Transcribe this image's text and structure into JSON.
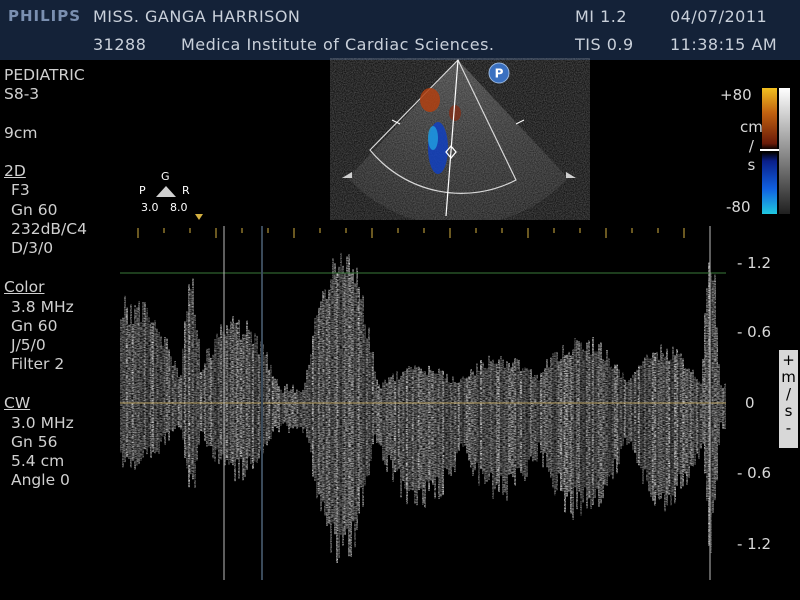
{
  "header": {
    "logo": "PHILIPS",
    "patient_name": "MISS. GANGA HARRISON",
    "patient_id": "31288",
    "institution": "Medica Institute of Cardiac Sciences.",
    "mi": "MI 1.2",
    "tis": "TIS 0.9",
    "date": "04/07/2011",
    "time": "11:38:15 AM"
  },
  "left_panel": {
    "preset": "PEDIATRIC",
    "probe": "S8-3",
    "depth": "9cm",
    "twod": {
      "title": "2D",
      "lines": [
        "F3",
        "Gn 60",
        "232dB/C4",
        "D/3/0"
      ]
    },
    "color": {
      "title": "Color",
      "lines": [
        "3.8 MHz",
        "Gn 60",
        "J/5/0",
        "Filter 2"
      ]
    },
    "cw": {
      "title": "CW",
      "lines": [
        "3.0 MHz",
        "Gn 56",
        "5.4 cm",
        "Angle 0"
      ]
    }
  },
  "sector": {
    "badge": "P"
  },
  "velocity_bar": {
    "top": "+80",
    "bottom": "-80",
    "unit": [
      "cm",
      "/",
      "s"
    ]
  },
  "sample_marker": {
    "g": "G",
    "p": "P",
    "r": "R",
    "left_val": "3.0",
    "right_val": "8.0"
  },
  "scale": {
    "labels": [
      "- 1.2",
      "- 0.6",
      "0",
      "- 0.6",
      "- 1.2"
    ],
    "unit_box": [
      "+",
      "m",
      "/",
      "s",
      "-"
    ]
  },
  "colors": {
    "header_bg": "#142238",
    "baseline": "#b8a060",
    "top_line": "#3a7a3a",
    "tick": "#d4b040"
  }
}
